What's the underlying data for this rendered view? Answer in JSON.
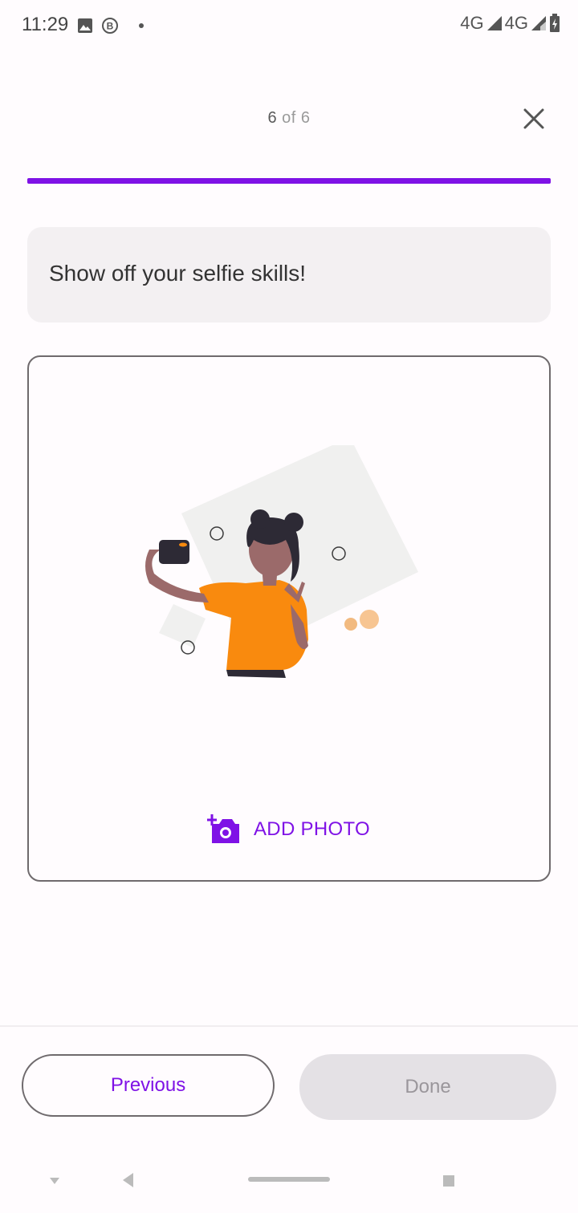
{
  "status_bar": {
    "time": "11:29",
    "network_1": "4G",
    "network_2": "4G",
    "icons": [
      "image-icon",
      "b-circle-icon",
      "dot-icon",
      "signal-icon",
      "signal-icon",
      "battery-icon"
    ]
  },
  "header": {
    "step_current": "6",
    "step_separator": "of",
    "step_total": "6",
    "close_icon": "close-icon"
  },
  "progress": {
    "fraction": 1.0,
    "color": "#7f12e6"
  },
  "prompt": {
    "text": "Show off your selfie skills!"
  },
  "photo_box": {
    "illustration": "selfie-illustration",
    "add_photo_label": "ADD PHOTO",
    "add_photo_icon": "add-photo-camera-icon"
  },
  "footer": {
    "previous_label": "Previous",
    "done_label": "Done"
  },
  "colors": {
    "accent": "#7f12e6",
    "orange": "#f98a0e",
    "disabled": "#e4e1e5"
  }
}
